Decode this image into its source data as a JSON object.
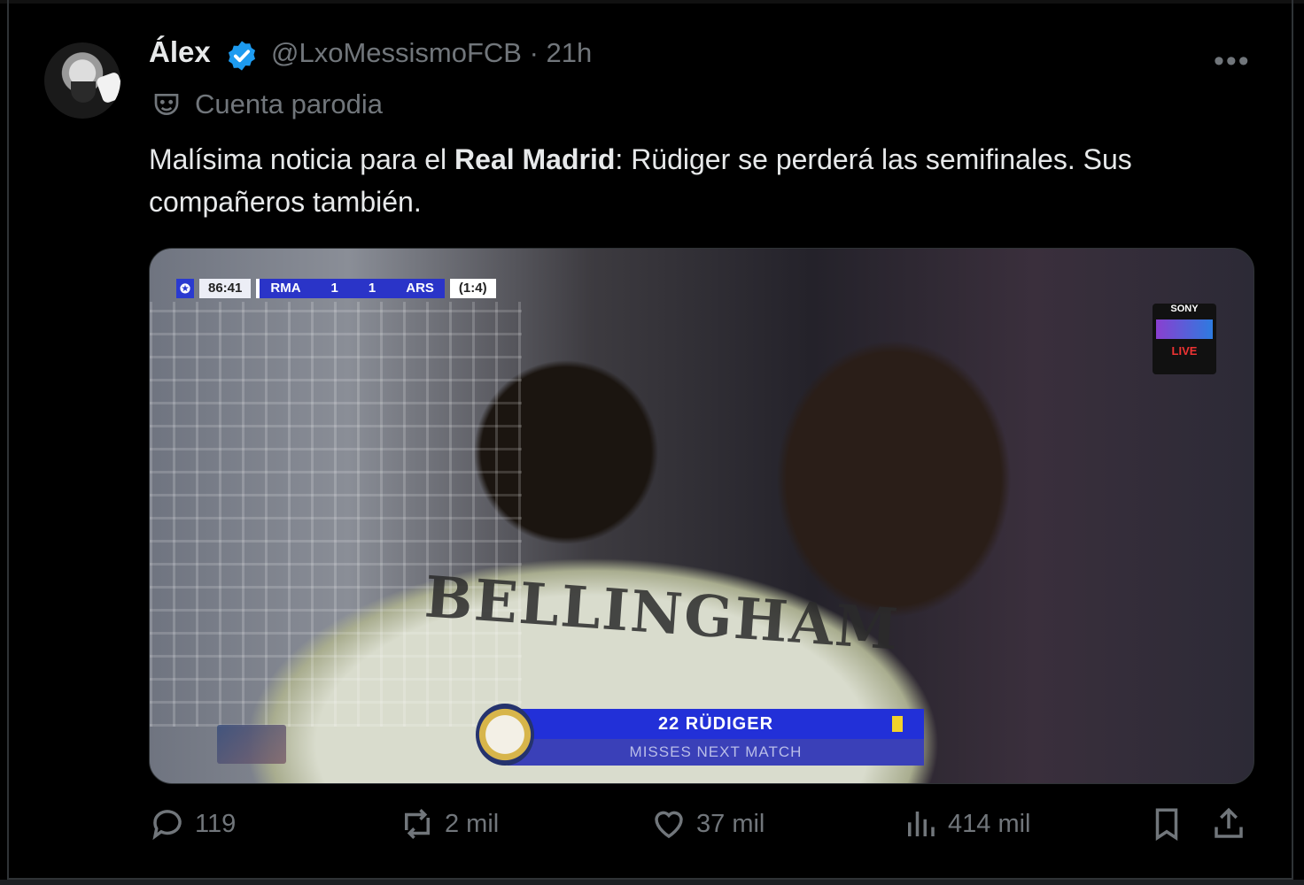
{
  "author": {
    "name": "Álex",
    "handle": "@LxoMessismoFCB",
    "time_sep": "·",
    "time": "21h",
    "label": "Cuenta parodia"
  },
  "tweet": {
    "text_pre": "Malísima noticia para el ",
    "text_bold": "Real Madrid",
    "text_post": ": Rüdiger se perderá las semifinales. Sus compañeros también."
  },
  "media": {
    "score_time": "86:41",
    "home_team": "RMA",
    "home_score": "1",
    "away_score": "1",
    "away_team": "ARS",
    "aggregate": "(1:4)",
    "jersey_name": "BELLINGHAM",
    "lower_third_title": "22 RÜDIGER",
    "lower_third_sub": "MISSES NEXT MATCH",
    "channel_brand": "SONY",
    "channel_live": "LIVE"
  },
  "actions": {
    "replies": "119",
    "reposts": "2 mil",
    "likes": "37 mil",
    "views": "414 mil"
  },
  "colors": {
    "background": "#000000",
    "text": "#e7e9ea",
    "muted": "#71767b",
    "verified": "#1d9bf0"
  },
  "icons": [
    "verified-badge-icon",
    "more-icon",
    "parody-mask-icon",
    "reply-icon",
    "repost-icon",
    "like-icon",
    "views-icon",
    "bookmark-icon",
    "share-icon"
  ]
}
